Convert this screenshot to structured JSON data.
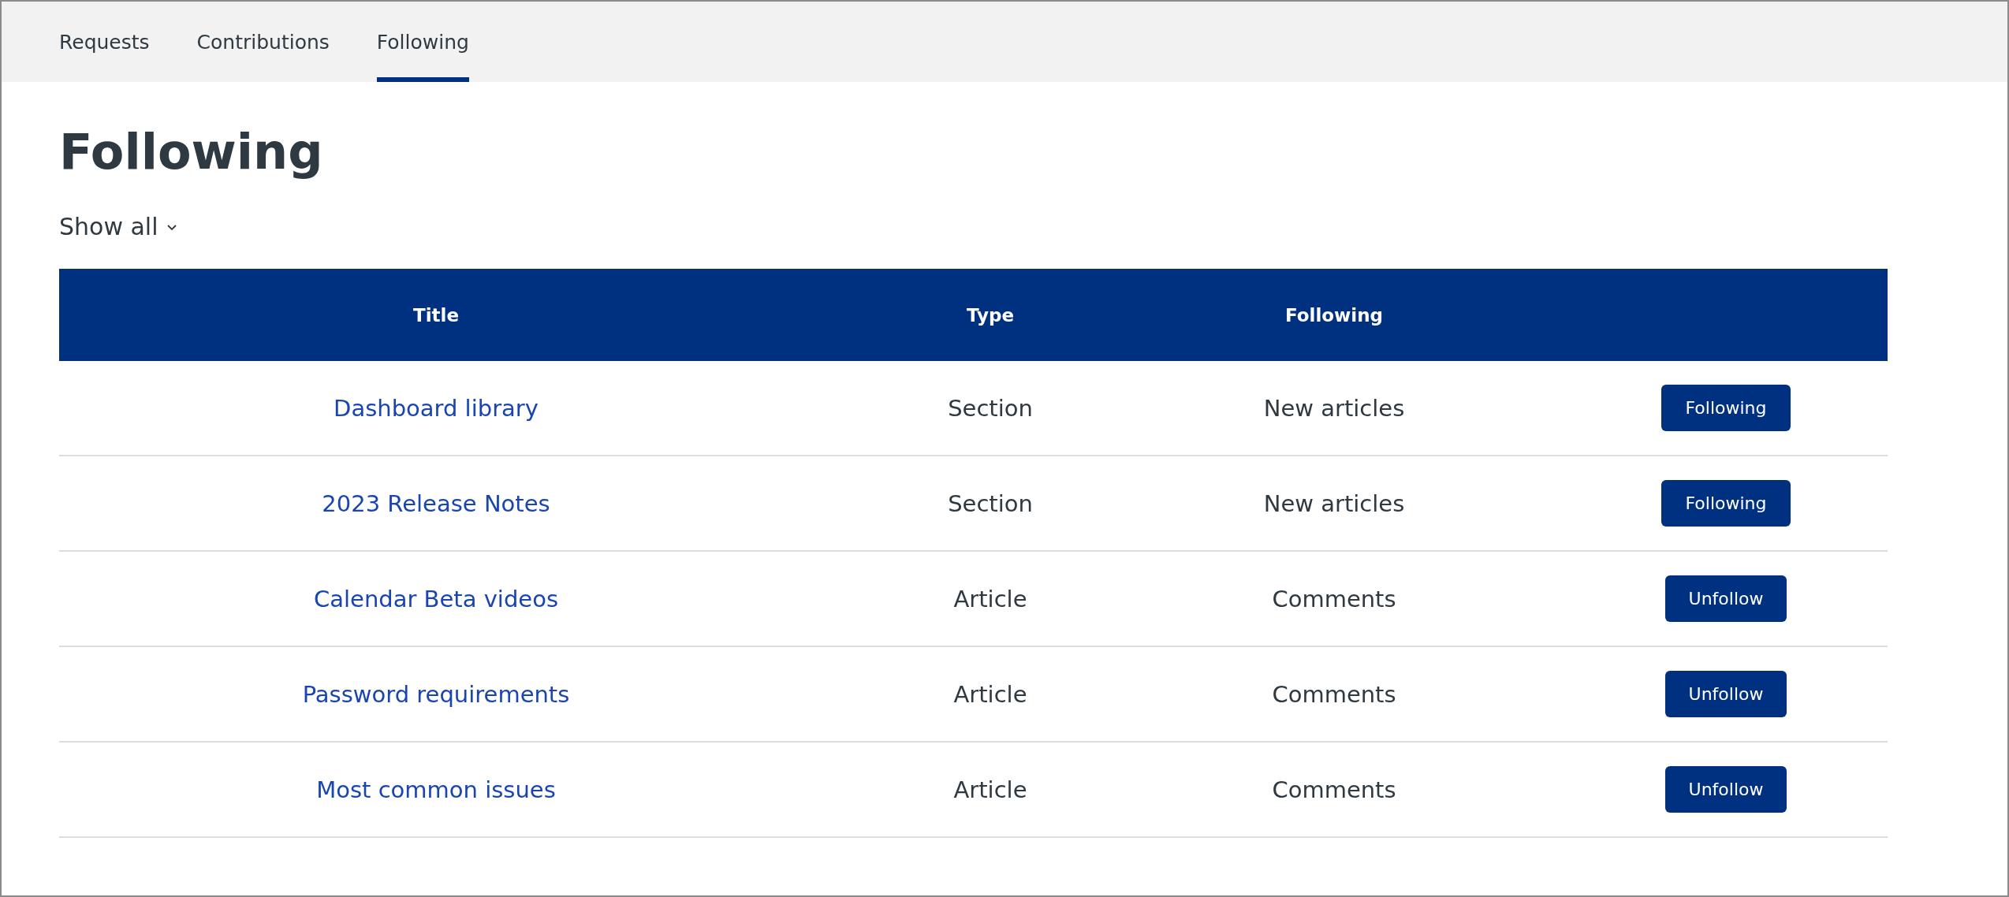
{
  "tabs": [
    {
      "label": "Requests",
      "selected": false
    },
    {
      "label": "Contributions",
      "selected": false
    },
    {
      "label": "Following",
      "selected": true
    }
  ],
  "heading": "Following",
  "filter": {
    "label": "Show all"
  },
  "table": {
    "columns": [
      "Title",
      "Type",
      "Following"
    ],
    "rows": [
      {
        "title": "Dashboard library",
        "type": "Section",
        "following": "New articles",
        "button": "Following"
      },
      {
        "title": "2023 Release Notes",
        "type": "Section",
        "following": "New articles",
        "button": "Following"
      },
      {
        "title": "Calendar Beta videos",
        "type": "Article",
        "following": "Comments",
        "button": "Unfollow"
      },
      {
        "title": "Password requirements",
        "type": "Article",
        "following": "Comments",
        "button": "Unfollow"
      },
      {
        "title": "Most common issues",
        "type": "Article",
        "following": "Comments",
        "button": "Unfollow"
      }
    ]
  }
}
